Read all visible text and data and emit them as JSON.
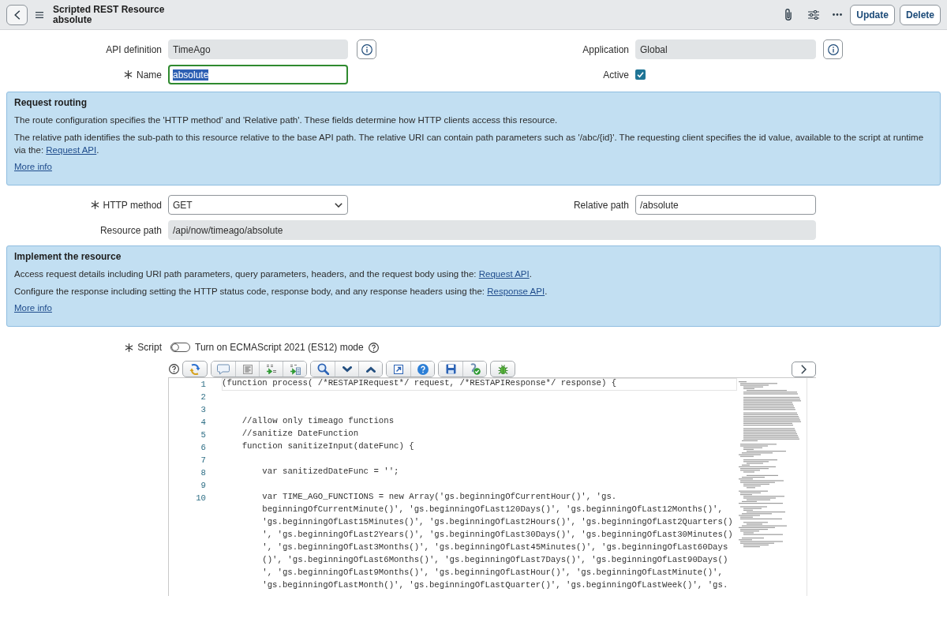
{
  "header": {
    "title": "Scripted REST Resource",
    "subtitle": "absolute",
    "buttons": [
      "Update",
      "Delete"
    ]
  },
  "fields_top": [
    {
      "label": "API definition",
      "kind": "reference",
      "value": "TimeAgo",
      "required": false,
      "readonly": true,
      "focused": false
    },
    {
      "label": "Application",
      "kind": "reference",
      "value": "Global",
      "required": false,
      "readonly": true,
      "focused": false
    },
    {
      "label": "Name",
      "kind": "text",
      "value": "absolute",
      "required": true,
      "readonly": false,
      "focused": true
    },
    {
      "label": "Active",
      "kind": "checkbox",
      "required": false,
      "checked": true
    }
  ],
  "request_routing": {
    "title": "Request routing",
    "paragraphs": [
      {
        "text": "The route configuration specifies the 'HTTP method' and 'Relative path'. These fields determine how HTTP clients access this resource."
      },
      {
        "text": "The relative path identifies the sub-path to this resource relative to the base API path. The relative URI can contain path parameters such as '/abc/{id}'. The requesting client specifies the id value, available to the script at runtime via the: ",
        "link": "Request API",
        "after": "."
      }
    ],
    "more_info": "More info"
  },
  "fields_routing": [
    {
      "label": "HTTP method",
      "kind": "select",
      "value": "GET",
      "required": true,
      "readonly": false,
      "focused": false
    },
    {
      "label": "Relative path",
      "kind": "text",
      "value": "/absolute",
      "required": false,
      "readonly": false,
      "focused": false
    }
  ],
  "resource_path": {
    "label": "Resource path",
    "value": "/api/now/timeago/absolute",
    "readonly": true
  },
  "implement_resource": {
    "title": "Implement the resource",
    "paragraphs": [
      {
        "text": "Access request details including URI path parameters, query parameters, headers, and the request body using the: ",
        "link": "Request API",
        "after": "."
      },
      {
        "text": "Configure the response including setting the HTTP status code, response body, and any response headers using the: ",
        "link": "Response API",
        "after": "."
      }
    ],
    "more_info": "More info"
  },
  "script": {
    "label": "Script",
    "required": true,
    "es_mode": {
      "label": "Turn on ECMAScript 2021 (ES12) mode",
      "on": false
    },
    "lines": [
      {
        "number": "1",
        "text": "(function process( /*RESTAPIRequest*/ request, /*RESTAPIResponse*/ response) {",
        "current": true
      },
      {
        "number": "2",
        "current": false
      },
      {
        "number": "3",
        "current": false
      },
      {
        "number": "4",
        "text": "    //allow only timeago functions",
        "current": false
      },
      {
        "number": "5",
        "text": "    //sanitize DateFunction",
        "current": false
      },
      {
        "number": "6",
        "text": "    function sanitizeInput(dateFunc) {",
        "current": false
      },
      {
        "number": "7",
        "current": false
      },
      {
        "number": "8",
        "text": "        var sanitizedDateFunc = '';",
        "current": false
      },
      {
        "number": "9",
        "current": false
      },
      {
        "number": "10",
        "text": "        var TIME_AGO_FUNCTIONS = new Array('gs.beginningOfCurrentHour()', 'gs.",
        "current": false,
        "wrapped": [
          "beginningOfCurrentMinute()', 'gs.beginningOfLast120Days()', 'gs.beginningOfLast12Months()',",
          "'gs.beginningOfLast15Minutes()', 'gs.beginningOfLast2Hours()', 'gs.beginningOfLast2Quarters()",
          "', 'gs.beginningOfLast2Years()', 'gs.beginningOfLast30Days()', 'gs.beginningOfLast30Minutes()",
          "', 'gs.beginningOfLast3Months()', 'gs.beginningOfLast45Minutes()', 'gs.beginningOfLast60Days",
          "()', 'gs.beginningOfLast6Months()', 'gs.beginningOfLast7Days()', 'gs.beginningOfLast90Days()",
          "', 'gs.beginningOfLast9Months()', 'gs.beginningOfLastHour()', 'gs.beginningOfLastMinute()',",
          "'gs.beginningOfLastMonth()', 'gs.beginningOfLastQuarter()', 'gs.beginningOfLastWeek()', 'gs."
        ]
      }
    ]
  }
}
